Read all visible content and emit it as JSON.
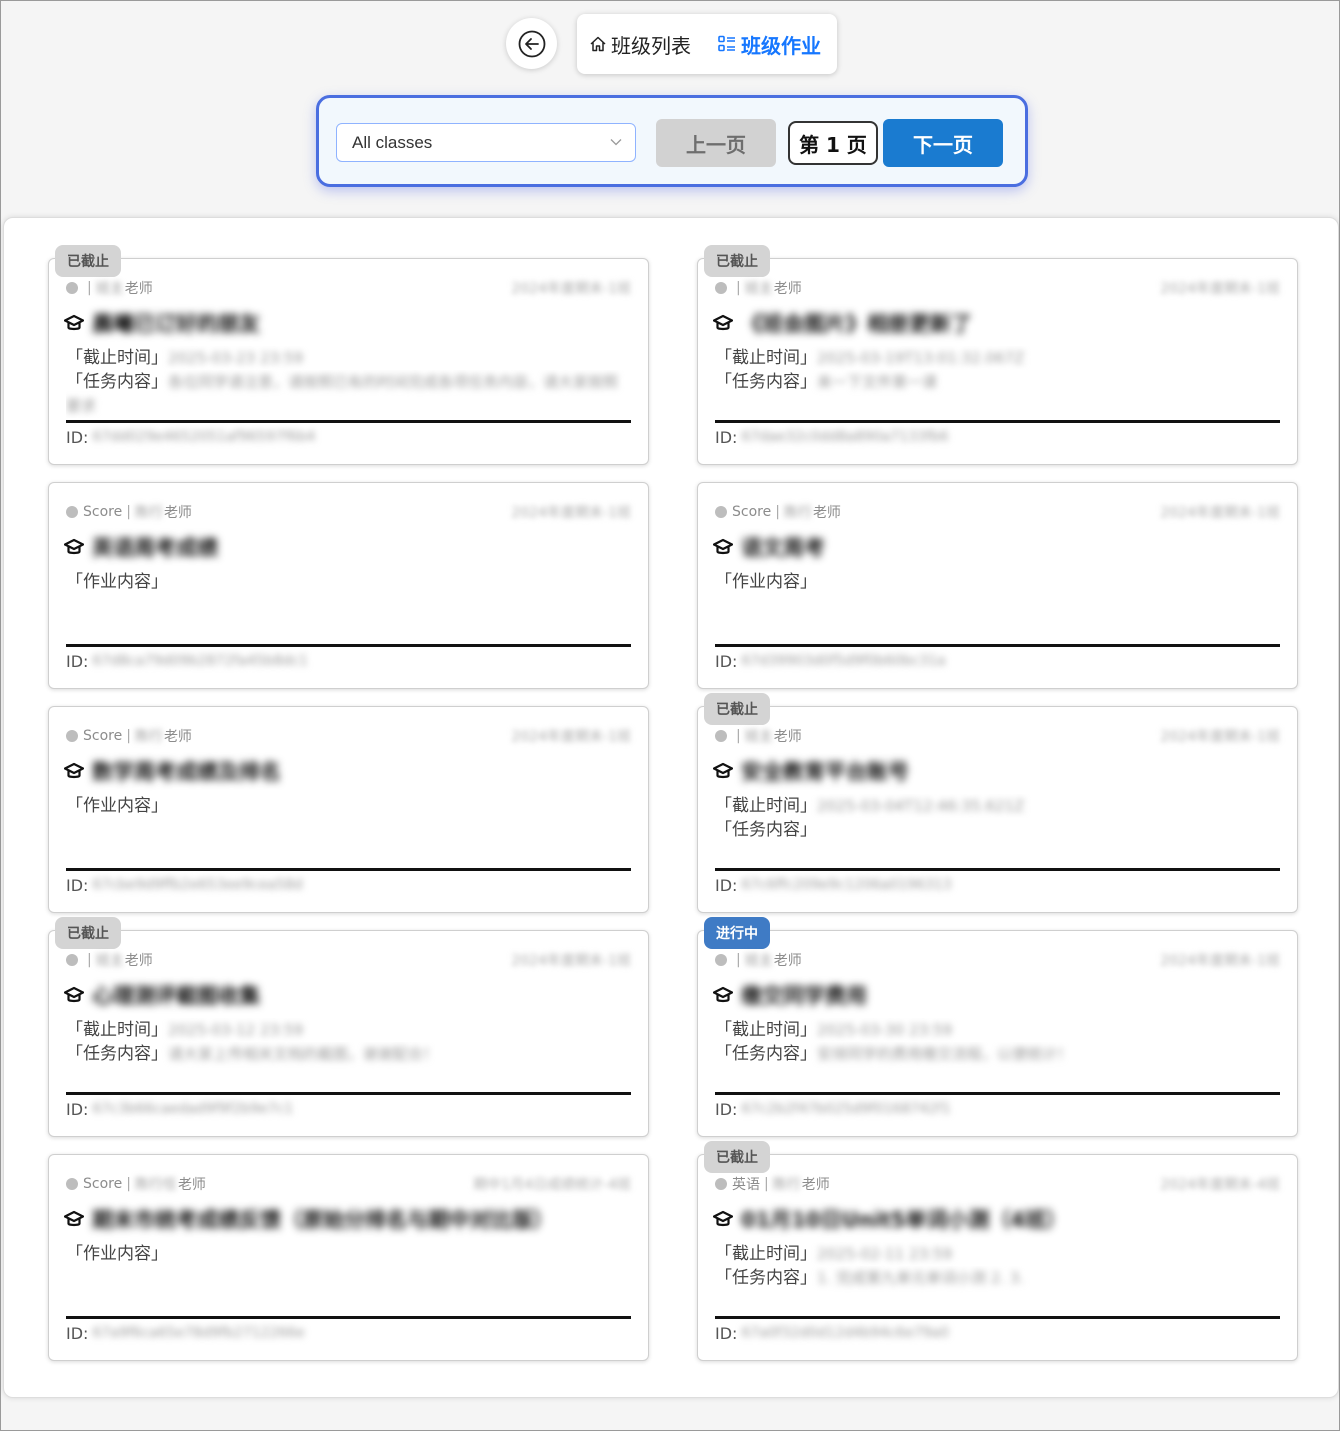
{
  "nav": {
    "tabs": [
      {
        "label": "班级列表",
        "icon": "home-icon"
      },
      {
        "label": "班级作业",
        "icon": "list-icon"
      }
    ]
  },
  "toolbar": {
    "class_select_value": "All classes",
    "prev_label": "上一页",
    "page_label": "第 1 页",
    "next_label": "下一页"
  },
  "labels": {
    "deadline": "「截止时间」",
    "task_content": "「任务内容」",
    "homework_content": "「作业内容」",
    "id_prefix": "ID:",
    "teacher_suffix": "老师",
    "separator": "|"
  },
  "colors": {
    "accent": "#1677ff",
    "next_button": "#1a7bd0",
    "badge_closed": "#d4d4d4",
    "badge_ongoing": "#3f7bc5"
  },
  "cards": [
    {
      "badge": "已截止",
      "badge_type": "closed",
      "subject": "",
      "teacher": "班主",
      "date": "2024年度期末-1班",
      "title": "晨曦已订好的朋友",
      "type": "task",
      "deadline": "2025-03-23 23:59",
      "content": "各位同学请注意，请按照已有的时间完成各项任务内容，请大家按照要求",
      "id": "67dd029e4652051af96597f6b4"
    },
    {
      "badge": "已截止",
      "badge_type": "closed",
      "subject": "",
      "teacher": "班主",
      "date": "2024年度期末-1班",
      "title": "《班会图片》相册更新了",
      "type": "task",
      "deadline": "2025-03-19T13:01:32.067Z",
      "content": "来一下文件第一课",
      "id": "67dae32c0dd8a890a7133fb6"
    },
    {
      "badge": "",
      "badge_type": "",
      "subject": "Score",
      "teacher": "陈行",
      "date": "2024年度期末-1班",
      "title": "英语周考成绩",
      "type": "homework",
      "deadline": "",
      "content": "",
      "id": "67d8ca79d09b2872fa45b8dc1"
    },
    {
      "badge": "",
      "badge_type": "",
      "subject": "Score",
      "teacher": "陈行",
      "date": "2024年度期末-1班",
      "title": "语文周考",
      "type": "homework",
      "deadline": "",
      "content": "",
      "id": "67d39903d0f5d9f0b60bc31a"
    },
    {
      "badge": "",
      "badge_type": "",
      "subject": "Score",
      "teacher": "陈行",
      "date": "2024年度期末-1班",
      "title": "数学周考成绩及排名",
      "type": "homework",
      "deadline": "",
      "content": "",
      "id": "67cbe9d9ffb2e653ee9cea58d"
    },
    {
      "badge": "已截止",
      "badge_type": "closed",
      "subject": "",
      "teacher": "班主",
      "date": "2024年度期末-1班",
      "title": "安全教育平台账号",
      "type": "task",
      "deadline": "2025-03-04T12:46:35.621Z",
      "content": "",
      "id": "67c6ffc209e9c1206a0196313"
    },
    {
      "badge": "已截止",
      "badge_type": "closed",
      "subject": "",
      "teacher": "班主",
      "date": "2024年度期末-1班",
      "title": "心理测评截图收集",
      "type": "task",
      "deadline": "2025-03-12 23:59",
      "content": "请大家上传相关文档的截图，谢谢配合！",
      "id": "67c3b66caedad9f9f2b9e7c1"
    },
    {
      "badge": "进行中",
      "badge_type": "ongoing",
      "subject": "",
      "teacher": "班主",
      "date": "2024年度期末-1班",
      "title": "缴交同学费用",
      "type": "task",
      "deadline": "2025-03-30 23:59",
      "content": "安排同学的费用缴交流程，以便统计！",
      "id": "67c2b2f47b025d9f0168742f1"
    },
    {
      "badge": "",
      "badge_type": "",
      "subject": "Score",
      "teacher": "陈行任",
      "date": "期中1月4日成绩统计-4班",
      "title": "期末市统考成绩反馈（原始分排名与期中对比版）",
      "type": "homework",
      "deadline": "",
      "content": "",
      "id": "67a9f6ca65e78d9fb2712266e"
    },
    {
      "badge": "已截止",
      "badge_type": "closed",
      "subject": "英语",
      "teacher": "陈行",
      "date": "2024年度期末-4班",
      "title": "01月10日Unit5单词小测（4班）",
      "type": "task",
      "deadline": "2025-02-11 23:59",
      "content": "1. 完成第九单元单词小测 2. 3.",
      "id": "67a0f32d0d12d4b94c6e79a0"
    }
  ]
}
